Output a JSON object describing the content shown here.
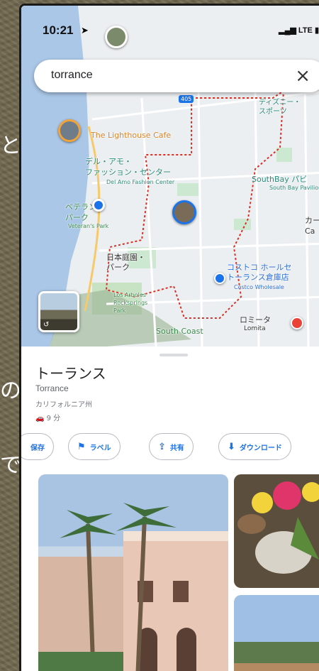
{
  "background": {
    "glyphs": [
      "と",
      "の",
      "で"
    ]
  },
  "status_bar": {
    "time": "10:21",
    "network": "LTE"
  },
  "search": {
    "value": "torrance",
    "close_icon": "close-icon"
  },
  "map": {
    "labels": {
      "lighthouse": "The Lighthouse Cafe",
      "del_amo": "デル・アモ・\nファッション・センター",
      "del_amo_en": "Del Amo Fashion Center",
      "southbay": "SouthBay パビ",
      "southbay_en": "South Bay Pavilion",
      "veterans": "ベテランズ\nパーク",
      "veterans_en": "Veteran's Park",
      "japanese_garden": "日本庭園・\nパーク",
      "costco": "コストコ ホールセ\nトーランス倉庫店",
      "costco_en": "Costco Wholesale",
      "los_arboles": "Los Arboles\nRocksprings\nPark",
      "southcoast": "South Coast",
      "lomita": "ロミータ",
      "lomita_en": "Lomita",
      "disneyana": "ディズニー・\nスポーツ",
      "carson": "カー\nCa",
      "highway": "405"
    }
  },
  "place": {
    "title": "トーランス",
    "subtitle": "Torrance",
    "region": "カリフォルニア州",
    "drive": "9 分"
  },
  "actions": {
    "save": "保存",
    "label": "ラベル",
    "share": "共有",
    "download": "ダウンロード"
  },
  "colors": {
    "accent": "#1a73e8",
    "boundary": "#d93025",
    "ocean": "#aac7e8"
  }
}
